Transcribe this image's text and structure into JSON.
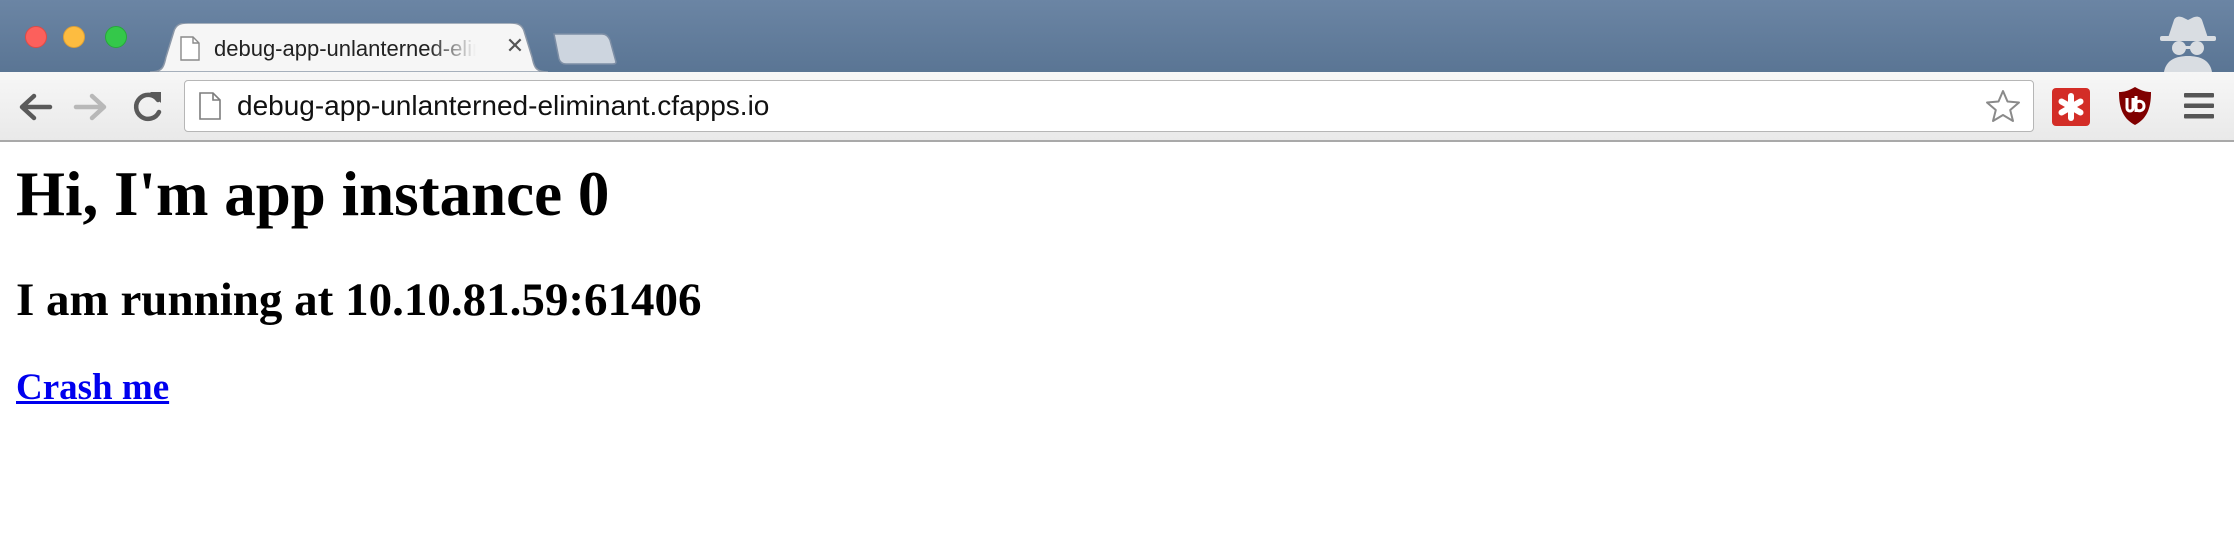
{
  "browser": {
    "window_controls": [
      "close",
      "minimize",
      "maximize"
    ],
    "tabs": [
      {
        "title": "debug-app-unlanterned-eliminant.cfapps.io",
        "active": true,
        "favicon": "page-icon",
        "close_glyph": "✕"
      }
    ],
    "new_tab_icon": "new-tab-icon",
    "profile_icon": "incognito-icon",
    "nav": {
      "back_icon": "back-arrow-icon",
      "forward_icon": "forward-arrow-icon",
      "reload_icon": "reload-icon"
    },
    "omnibox": {
      "url": "debug-app-unlanterned-eliminant.cfapps.io",
      "page_icon": "page-icon",
      "bookmark_icon": "star-icon"
    },
    "extensions": [
      {
        "name": "LastPass",
        "icon": "lastpass-icon",
        "color": "#d32d27"
      },
      {
        "name": "uBlock",
        "icon": "ublock-icon",
        "color": "#800000"
      }
    ],
    "menu_icon": "hamburger-menu-icon"
  },
  "page": {
    "heading": "Hi, I'm app instance 0",
    "subheading": "I am running at 10.10.81.59:61406",
    "crash_link": "Crash me"
  },
  "colors": {
    "tab_strip": "#5f7a99",
    "link": "#0000ee",
    "close_button": "#fc605c",
    "minimize_button": "#fdbc40",
    "maximize_button": "#34c84a"
  }
}
